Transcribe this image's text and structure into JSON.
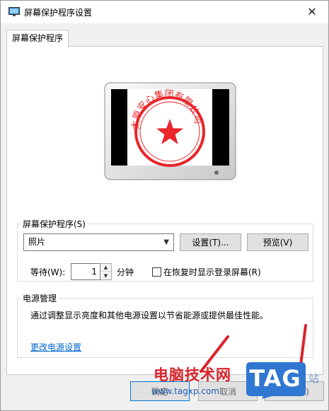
{
  "window": {
    "title": "屏幕保护程序设置",
    "close_glyph": "✕"
  },
  "tab": {
    "label": "屏幕保护程序"
  },
  "preview": {
    "seal_text": "太原安心集团有限公司",
    "seal_color": "#e8262b"
  },
  "screensaver_group": {
    "legend": "屏幕保护程序(S)",
    "selected": "照片",
    "settings_label": "设置(T)...",
    "preview_label": "预览(V)",
    "wait_label": "等待(W):",
    "wait_value": "1",
    "minutes_label": "分钟",
    "resume_label": "在恢复时显示登录屏幕(R)",
    "resume_checked": false
  },
  "power_group": {
    "legend": "电源管理",
    "description": "通过调整显示亮度和其他电源设置以节省能源或提供最佳性能。",
    "link": "更改电源设置"
  },
  "footer": {
    "ok_label": "确定",
    "cancel_label": "取消",
    "apply_label": "应用(A)"
  },
  "watermark": {
    "site_name": "电脑技术网",
    "url": "www.tagxp.com",
    "tag": "TAG",
    "corner_text": "站"
  },
  "colors": {
    "accent": "#0078d7",
    "link": "#0066cc",
    "arrow": "#d9242d",
    "tag_bg": "#2f77d0"
  }
}
